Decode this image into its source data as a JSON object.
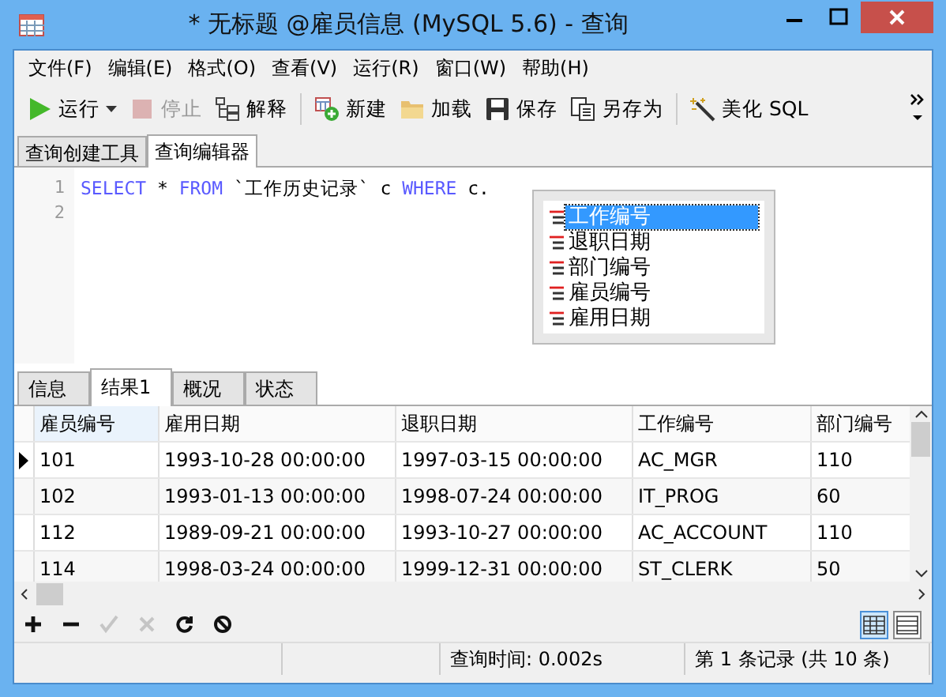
{
  "window": {
    "title": "* 无标题 @雇员信息 (MySQL 5.6) - 查询"
  },
  "menu": [
    "文件(F)",
    "编辑(E)",
    "格式(O)",
    "查看(V)",
    "运行(R)",
    "窗口(W)",
    "帮助(H)"
  ],
  "toolbar": [
    {
      "kind": "run",
      "label": "运行",
      "disabled": false,
      "dropdown": true
    },
    {
      "kind": "stop",
      "label": "停止",
      "disabled": true,
      "dropdown": false
    },
    {
      "kind": "explain",
      "label": "解释",
      "disabled": false,
      "dropdown": false
    },
    {
      "kind": "new",
      "label": "新建",
      "disabled": false,
      "dropdown": false
    },
    {
      "kind": "load",
      "label": "加载",
      "disabled": false,
      "dropdown": false
    },
    {
      "kind": "save",
      "label": "保存",
      "disabled": false,
      "dropdown": false
    },
    {
      "kind": "saveas",
      "label": "另存为",
      "disabled": false,
      "dropdown": false
    },
    {
      "kind": "beautify",
      "label": "美化 SQL",
      "disabled": false,
      "dropdown": false
    }
  ],
  "editor_tabs": [
    {
      "label": "查询创建工具",
      "selected": false
    },
    {
      "label": "查询编辑器",
      "selected": true
    }
  ],
  "editor": {
    "lines": [
      {
        "number": "1",
        "tokens": [
          {
            "kind": "keyword",
            "text": "SELECT"
          },
          {
            "kind": "plain",
            "text": " * "
          },
          {
            "kind": "keyword",
            "text": "FROM"
          },
          {
            "kind": "plain",
            "text": " `工作历史记录` c "
          },
          {
            "kind": "keyword",
            "text": "WHERE"
          },
          {
            "kind": "plain",
            "text": " c."
          }
        ]
      },
      {
        "number": "2"
      }
    ],
    "autocomplete": [
      {
        "label": "工作编号",
        "selected": true
      },
      {
        "label": "退职日期",
        "selected": false
      },
      {
        "label": "部门编号",
        "selected": false
      },
      {
        "label": "雇员编号",
        "selected": false
      },
      {
        "label": "雇用日期",
        "selected": false
      }
    ]
  },
  "result_tabs": [
    {
      "label": "信息",
      "selected": false
    },
    {
      "label": "结果1",
      "selected": true
    },
    {
      "label": "概况",
      "selected": false
    },
    {
      "label": "状态",
      "selected": false
    }
  ],
  "table": {
    "columns": [
      "雇员编号",
      "雇用日期",
      "退职日期",
      "工作编号",
      "部门编号"
    ],
    "rows": [
      {
        "current": true,
        "cells": [
          "101",
          "1993-10-28 00:00:00",
          "1997-03-15 00:00:00",
          "AC_MGR",
          "110"
        ]
      },
      {
        "current": false,
        "cells": [
          "102",
          "1993-01-13 00:00:00",
          "1998-07-24 00:00:00",
          "IT_PROG",
          "60"
        ]
      },
      {
        "current": false,
        "cells": [
          "112",
          "1989-09-21 00:00:00",
          "1993-10-27 00:00:00",
          "AC_ACCOUNT",
          "110"
        ]
      },
      {
        "current": false,
        "cells": [
          "114",
          "1998-03-24 00:00:00",
          "1999-12-31 00:00:00",
          "ST_CLERK",
          "50"
        ]
      }
    ]
  },
  "grid_toolbar": [
    {
      "kind": "add",
      "disabled": false
    },
    {
      "kind": "remove",
      "disabled": false
    },
    {
      "kind": "apply",
      "disabled": true
    },
    {
      "kind": "cancel",
      "disabled": true
    },
    {
      "kind": "refresh",
      "disabled": false
    },
    {
      "kind": "stop",
      "disabled": false
    }
  ],
  "view_modes": [
    {
      "kind": "grid",
      "selected": true
    },
    {
      "kind": "form",
      "selected": false
    }
  ],
  "status_bar": {
    "query_time": "查询时间: 0.002s",
    "record": "第 1 条记录 (共 10 条)"
  }
}
